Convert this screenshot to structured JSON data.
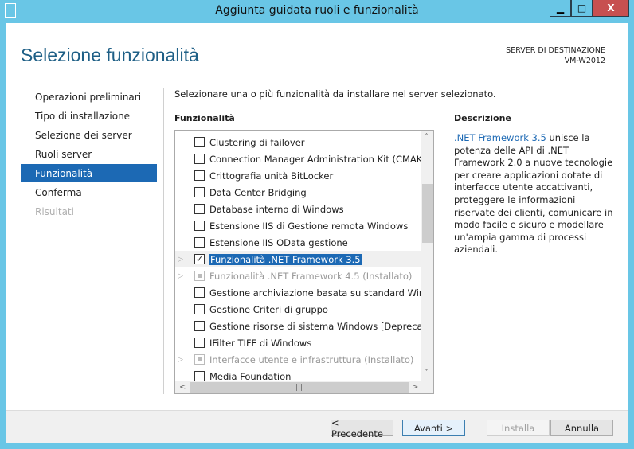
{
  "window": {
    "title": "Aggiunta guidata ruoli e funzionalità",
    "minimize": "▁",
    "maximize": "□",
    "close": "X"
  },
  "header": {
    "page_title": "Selezione funzionalità",
    "dest_label": "SERVER DI DESTINAZIONE",
    "dest_server": "VM-W2012"
  },
  "nav": {
    "items": [
      {
        "label": "Operazioni preliminari"
      },
      {
        "label": "Tipo di installazione"
      },
      {
        "label": "Selezione dei server"
      },
      {
        "label": "Ruoli server"
      },
      {
        "label": "Funzionalità",
        "selected": true
      },
      {
        "label": "Conferma"
      },
      {
        "label": "Risultati",
        "disabled": true
      }
    ]
  },
  "main": {
    "intro": "Selezionare una o più funzionalità da installare nel server selezionato.",
    "features_header": "Funzionalità",
    "description_header": "Descrizione",
    "description_link": ".NET Framework 3.5",
    "description_text": " unisce la potenza delle API di .NET Framework 2.0 a nuove tecnologie per creare applicazioni dotate di interfacce utente accattivanti, proteggere le informazioni riservate dei clienti, comunicare in modo facile e sicuro e modellare un'ampia gamma di processi aziendali.",
    "features": [
      {
        "label": "Clustering di failover",
        "checked": false
      },
      {
        "label": "Connection Manager Administration Kit (CMAK) R",
        "checked": false
      },
      {
        "label": "Crittografia unità BitLocker",
        "checked": false
      },
      {
        "label": "Data Center Bridging",
        "checked": false
      },
      {
        "label": "Database interno di Windows",
        "checked": false
      },
      {
        "label": "Estensione IIS di Gestione remota Windows",
        "checked": false
      },
      {
        "label": "Estensione IIS OData gestione",
        "checked": false
      },
      {
        "label": "Funzionalità .NET Framework 3.5",
        "checked": true,
        "expandable": true,
        "selected": true
      },
      {
        "label": "Funzionalità .NET Framework 4.5 (Installato)",
        "checked": "installed",
        "expandable": true,
        "disabled": true
      },
      {
        "label": "Gestione archiviazione basata su standard Window",
        "checked": false
      },
      {
        "label": "Gestione Criteri di gruppo",
        "checked": false
      },
      {
        "label": "Gestione risorse di sistema Windows [Deprecato]",
        "checked": false
      },
      {
        "label": "IFilter TIFF di Windows",
        "checked": false
      },
      {
        "label": "Interfacce utente e infrastruttura (Installato)",
        "checked": "installed",
        "expandable": true,
        "disabled": true
      },
      {
        "label": "Media Foundation",
        "checked": false
      }
    ]
  },
  "buttons": {
    "previous": "< Precedente",
    "next": "Avanti >",
    "install": "Installa",
    "cancel": "Annulla"
  },
  "colors": {
    "accent": "#1c69b4",
    "frame": "#69c6e6",
    "close": "#c75050"
  }
}
